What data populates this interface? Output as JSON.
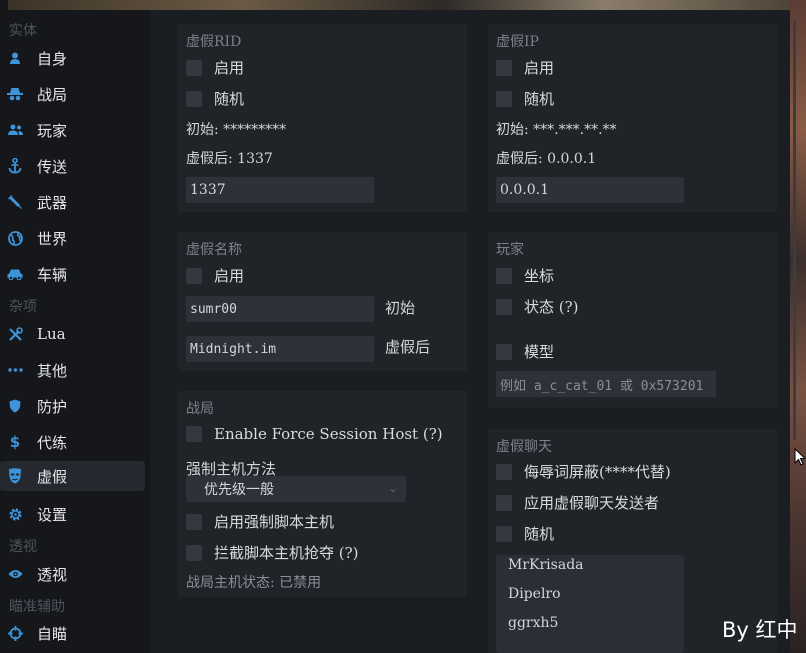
{
  "sidebar": {
    "sections": [
      {
        "title": "实体",
        "items": [
          {
            "label": "自身",
            "icon": "person-icon"
          },
          {
            "label": "战局",
            "icon": "spy-icon"
          },
          {
            "label": "玩家",
            "icon": "users-icon"
          },
          {
            "label": "传送",
            "icon": "anchor-icon"
          },
          {
            "label": "武器",
            "icon": "syringe-icon"
          },
          {
            "label": "世界",
            "icon": "globe-icon"
          },
          {
            "label": "车辆",
            "icon": "car-icon"
          }
        ]
      },
      {
        "title": "杂项",
        "items": [
          {
            "label": "Lua",
            "icon": "tools-icon"
          },
          {
            "label": "其他",
            "icon": "dots-icon"
          },
          {
            "label": "防护",
            "icon": "shield-icon"
          },
          {
            "label": "代练",
            "icon": "dollar-icon"
          },
          {
            "label": "虚假",
            "icon": "mask-icon",
            "active": true
          },
          {
            "label": "设置",
            "icon": "gear-icon"
          }
        ]
      },
      {
        "title": "透视",
        "items": [
          {
            "label": "透视",
            "icon": "eye-icon"
          }
        ]
      },
      {
        "title": "瞄准辅助",
        "items": [
          {
            "label": "自瞄",
            "icon": "crosshair-icon"
          }
        ]
      }
    ]
  },
  "panels": {
    "fake_rid": {
      "title": "虚假RID",
      "enable": "启用",
      "random": "随机",
      "original": "初始: *********",
      "fake_after": "虚假后: 1337",
      "input_value": "1337"
    },
    "fake_ip": {
      "title": "虚假IP",
      "enable": "启用",
      "random": "随机",
      "original": "初始: ***.***.**.**",
      "fake_after": "虚假后: 0.0.0.1",
      "input_value": "0.0.0.1"
    },
    "fake_name": {
      "title": "虚假名称",
      "enable": "启用",
      "original_value": "sumr00",
      "original_label": "初始",
      "fake_value": "Midnight.im",
      "fake_label": "虚假后"
    },
    "player": {
      "title": "玩家",
      "coords": "坐标",
      "status": "状态 (?)",
      "model": "模型",
      "model_placeholder": "例如 a_c_cat_01 或 0x573201"
    },
    "session": {
      "title": "战局",
      "force_host": "Enable Force Session Host (?)",
      "method_label": "强制主机方法",
      "method_value": "优先级一般",
      "script_host": "启用强制脚本主机",
      "block_script_host": "拦截脚本主机抢夺 (?)",
      "host_status": "战局主机状态: 已禁用"
    },
    "fake_chat": {
      "title": "虚假聊天",
      "profanity": "侮辱词屏蔽(****代替)",
      "apply_sender": "应用虚假聊天发送者",
      "random": "随机",
      "senders": [
        "MrKrisada",
        "Dipelro",
        "ggrxh5"
      ]
    }
  },
  "watermark": "By 红中",
  "colors": {
    "accent": "#3d94d9",
    "panel": "#202328",
    "background": "#1a1d22",
    "sidebar": "#15171b"
  }
}
